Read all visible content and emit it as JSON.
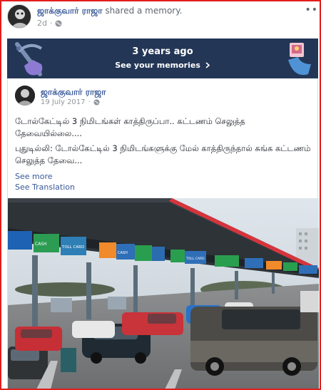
{
  "post": {
    "author": "ஜாக்குவார் ராஜா",
    "action": " shared a memory.",
    "time": "2d",
    "more": "••"
  },
  "memories_banner": {
    "title": "3 years ago",
    "link_label": "See your memories",
    "colors": {
      "background": "#233656",
      "text": "#ffffff"
    }
  },
  "shared_post": {
    "author": "ஜாக்குவார் ராஜா",
    "date": "19 July 2017",
    "paragraph1": "டோல்கேட்டில் 3 நிமிடங்கள் காத்திருப்பா.. கட்டணம் செலுத்த தேவையில்லை....",
    "paragraph2": "புதுடில்லி: டோல்கேட்டில் 3 நிமிடங்களுக்கு மேல் காத்திருந்தால் சுங்க கட்டணம் செலுத்த தேவை...",
    "see_more": "See more",
    "see_translation": "See Translation"
  },
  "photo": {
    "signs": [
      "CASH",
      "TOLL CARD",
      "CASH",
      "TOLL CARD"
    ]
  },
  "colors": {
    "link": "#385898",
    "frame": "#e11d1d",
    "canopy_edge": "#d8343c"
  },
  "icons": [
    "globe-icon",
    "chevron-right-icon"
  ]
}
